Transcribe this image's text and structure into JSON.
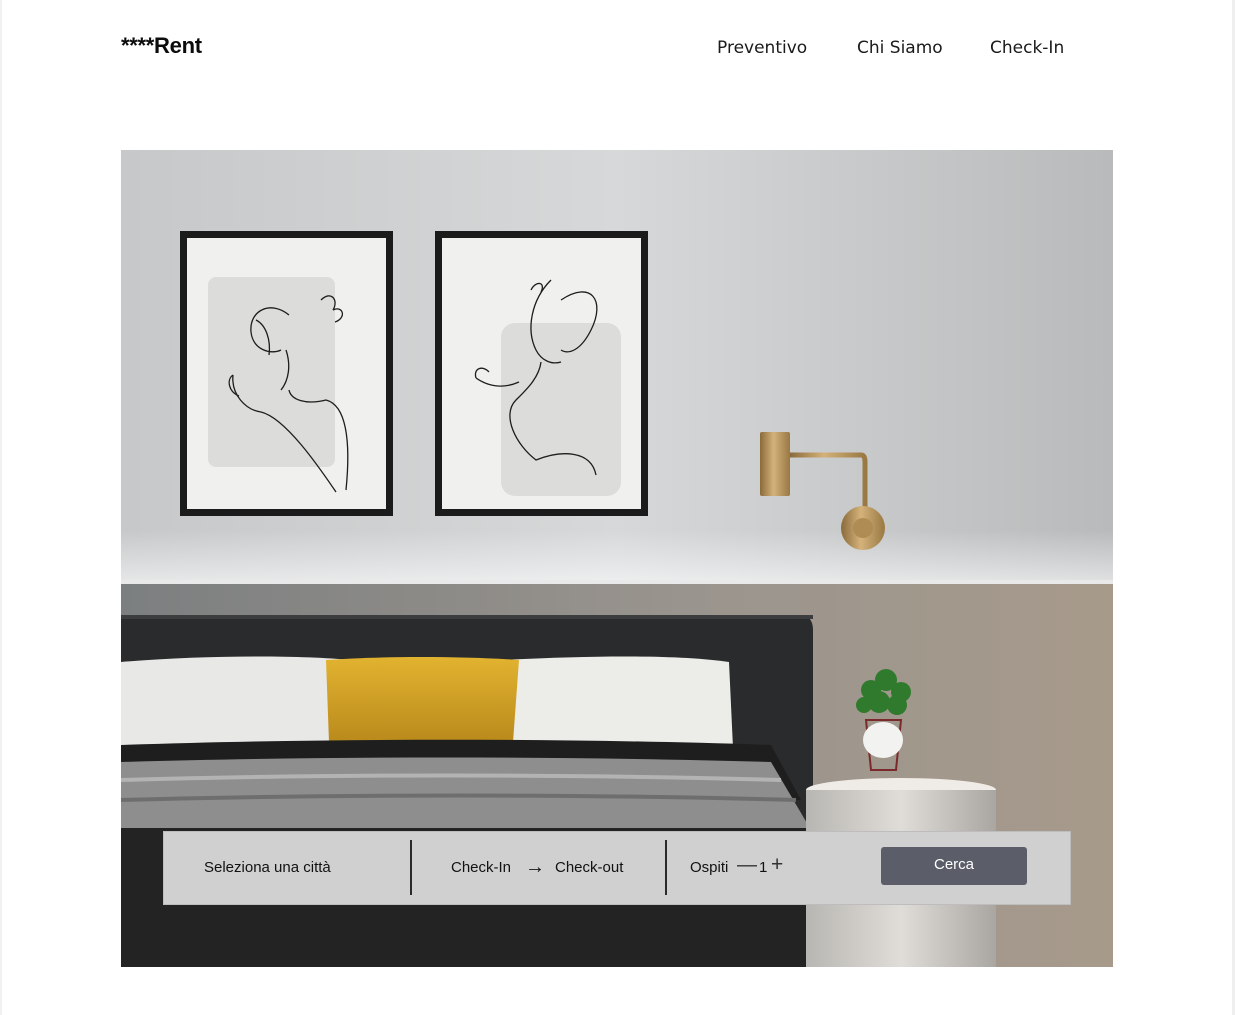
{
  "brand": {
    "logo": "****Rent"
  },
  "nav": {
    "items": [
      "Preventivo",
      "Chi Siamo",
      "Check-In"
    ]
  },
  "hero": {
    "image": "bedroom-interior-photo"
  },
  "search": {
    "city_placeholder": "Seleziona una città",
    "checkin_label": "Check-In",
    "arrow": "→",
    "checkout_label": "Check-out",
    "guests_label": "Ospiti",
    "guests_minus": "—",
    "guests_count": "1",
    "guests_plus": "+",
    "submit_label": "Cerca"
  },
  "colors": {
    "button_bg": "#5b5e69",
    "search_bar_bg": "#d0d0d0",
    "pillow_accent": "#d9a92a"
  }
}
